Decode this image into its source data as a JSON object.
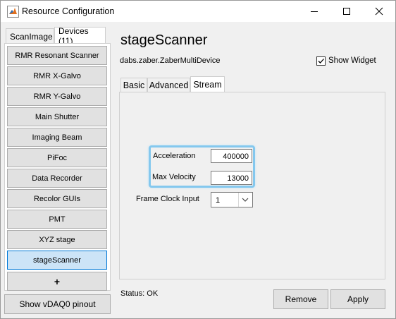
{
  "window": {
    "title": "Resource Configuration",
    "controls": [
      "minimize-icon",
      "maximize-icon",
      "close-icon"
    ]
  },
  "left_tabs": [
    {
      "label": "ScanImage",
      "active": false
    },
    {
      "label": "Devices (11)",
      "active": true
    }
  ],
  "devices": [
    {
      "label": "RMR Resonant Scanner",
      "selected": false
    },
    {
      "label": "RMR X-Galvo",
      "selected": false
    },
    {
      "label": "RMR Y-Galvo",
      "selected": false
    },
    {
      "label": "Main Shutter",
      "selected": false
    },
    {
      "label": "Imaging Beam",
      "selected": false
    },
    {
      "label": "PiFoc",
      "selected": false
    },
    {
      "label": "Data Recorder",
      "selected": false
    },
    {
      "label": "Recolor GUIs",
      "selected": false
    },
    {
      "label": "PMT",
      "selected": false
    },
    {
      "label": "XYZ stage",
      "selected": false
    },
    {
      "label": "stageScanner",
      "selected": true
    }
  ],
  "add_device_label": "+",
  "pinout_button": "Show vDAQ0 pinout",
  "device_panel": {
    "title": "stageScanner",
    "class_name": "dabs.zaber.ZaberMultiDevice",
    "show_widget_label": "Show Widget",
    "show_widget_checked": true,
    "tabs": [
      {
        "label": "Basic",
        "active": false
      },
      {
        "label": "Advanced",
        "active": false
      },
      {
        "label": "Stream",
        "active": true
      }
    ],
    "fields": {
      "acceleration_label": "Acceleration",
      "acceleration_value": "400000",
      "max_velocity_label": "Max Velocity",
      "max_velocity_value": "13000",
      "frame_clock_label": "Frame Clock Input",
      "frame_clock_value": "1"
    }
  },
  "status": "Status: OK",
  "buttons": {
    "remove": "Remove",
    "apply": "Apply"
  },
  "colors": {
    "selected_bg": "#cce4f7",
    "selected_border": "#0078d7",
    "highlight": "#84c8ee"
  }
}
